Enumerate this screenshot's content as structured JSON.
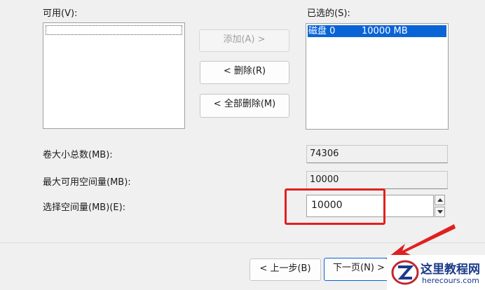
{
  "available": {
    "label": "可用(V):",
    "items": []
  },
  "selected": {
    "label": "已选的(S):",
    "items": [
      {
        "disk": "磁盘 0",
        "size": "10000 MB"
      }
    ]
  },
  "buttons": {
    "add": "添加(A) >",
    "remove": "< 删除(R)",
    "remove_all": "< 全部删除(M)"
  },
  "fields": {
    "total_label": "卷大小总数(MB):",
    "total_value": "74306",
    "max_label": "最大可用空间量(MB):",
    "max_value": "10000",
    "select_label": "选择空间量(MB)(E):",
    "select_value": "10000"
  },
  "footer": {
    "back": "< 上一步(B)",
    "next": "下一页(N) >"
  },
  "watermark": {
    "title": "这里教程网",
    "site": "herecours.com"
  },
  "colors": {
    "selection": "#0a64d6",
    "highlight_box": "#e02020",
    "arrow": "#e02020"
  }
}
